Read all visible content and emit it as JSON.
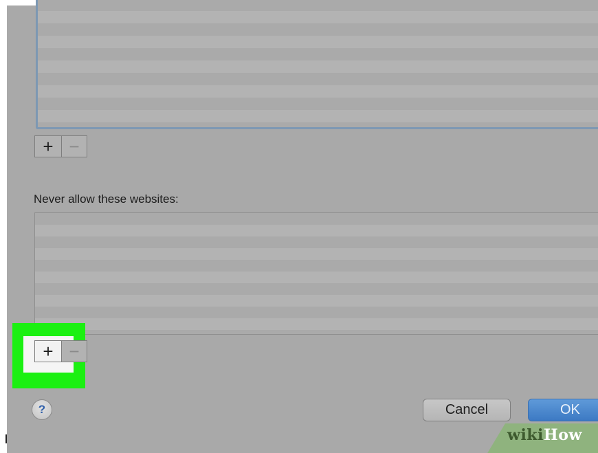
{
  "allowed_list": {
    "add_button": "+",
    "remove_button": "−"
  },
  "never_allow": {
    "label": "Never allow these websites:",
    "add_button": "+",
    "remove_button": "−"
  },
  "footer": {
    "help_button": "?",
    "cancel_label": "Cancel",
    "ok_label": "OK"
  },
  "watermark": {
    "wiki": "wiki",
    "how": "How"
  },
  "colors": {
    "highlight": "#1bf012",
    "accent_ok": "#3c79c3",
    "focus_ring": "#7d98b3"
  },
  "icons": {
    "help": "question-mark-icon",
    "add": "plus-icon",
    "remove": "minus-icon"
  }
}
